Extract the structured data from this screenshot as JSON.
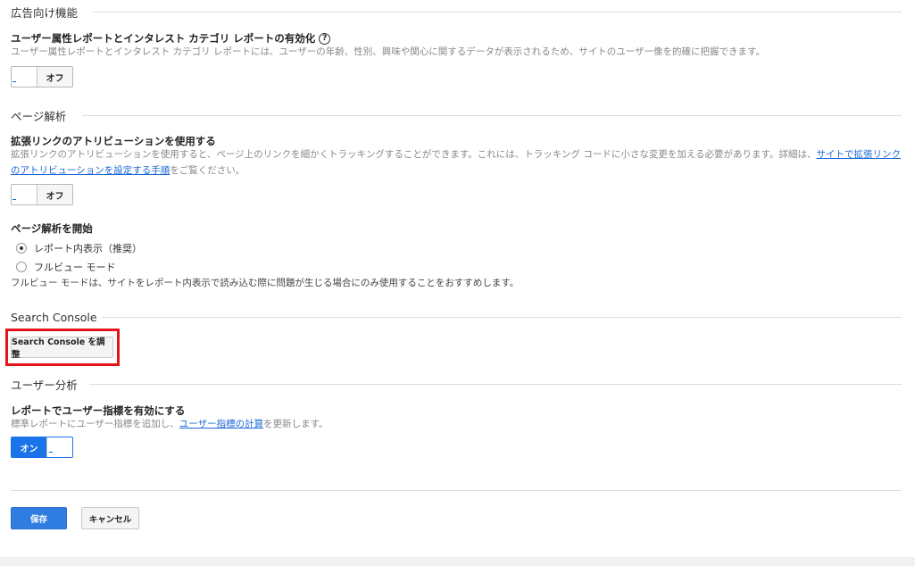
{
  "ad_features": {
    "header": "広告向け機能",
    "setting_title": "ユーザー属性レポートとインタレスト カテゴリ レポートの有効化",
    "help_glyph": "?",
    "description": "ユーザー属性レポートとインタレスト カテゴリ レポートには、ユーザーの年齢、性別、興味や関心に関するデータが表示されるため、サイトのユーザー像を的確に把握できます。",
    "toggle_label": "オフ"
  },
  "page_analytics": {
    "header": "ページ解析",
    "setting_title": "拡張リンクのアトリビューションを使用する",
    "description_prefix": "拡張リンクのアトリビューションを使用すると、ページ上のリンクを細かくトラッキングすることができます。これには、トラッキング コードに小さな変更を加える必要があります。詳細は、",
    "description_link": "サイトで拡張リンクのアトリビューションを設定する手順",
    "description_suffix": "をご覧ください。",
    "toggle_label": "オフ",
    "start_title": "ページ解析を開始",
    "options": [
      {
        "label": "レポート内表示（推奨）",
        "checked": true
      },
      {
        "label": "フルビュー モード",
        "checked": false
      }
    ],
    "note": "フルビュー モードは、サイトをレポート内表示で読み込む際に問題が生じる場合にのみ使用することをおすすめします。"
  },
  "search_console": {
    "header": "Search Console",
    "button_label": "Search Console を調整",
    "highlight_color": "#e6141a"
  },
  "user_analysis": {
    "header": "ユーザー分析",
    "setting_title": "レポートでユーザー指標を有効にする",
    "description_prefix": "標準レポートにユーザー指標を追加し、",
    "description_link": "ユーザー指標の計算",
    "description_suffix": "を更新します。",
    "toggle_label": "オン"
  },
  "footer": {
    "save_label": "保存",
    "cancel_label": "キャンセル"
  },
  "colors": {
    "accent": "#1a73e8",
    "link": "#1a66d6"
  }
}
